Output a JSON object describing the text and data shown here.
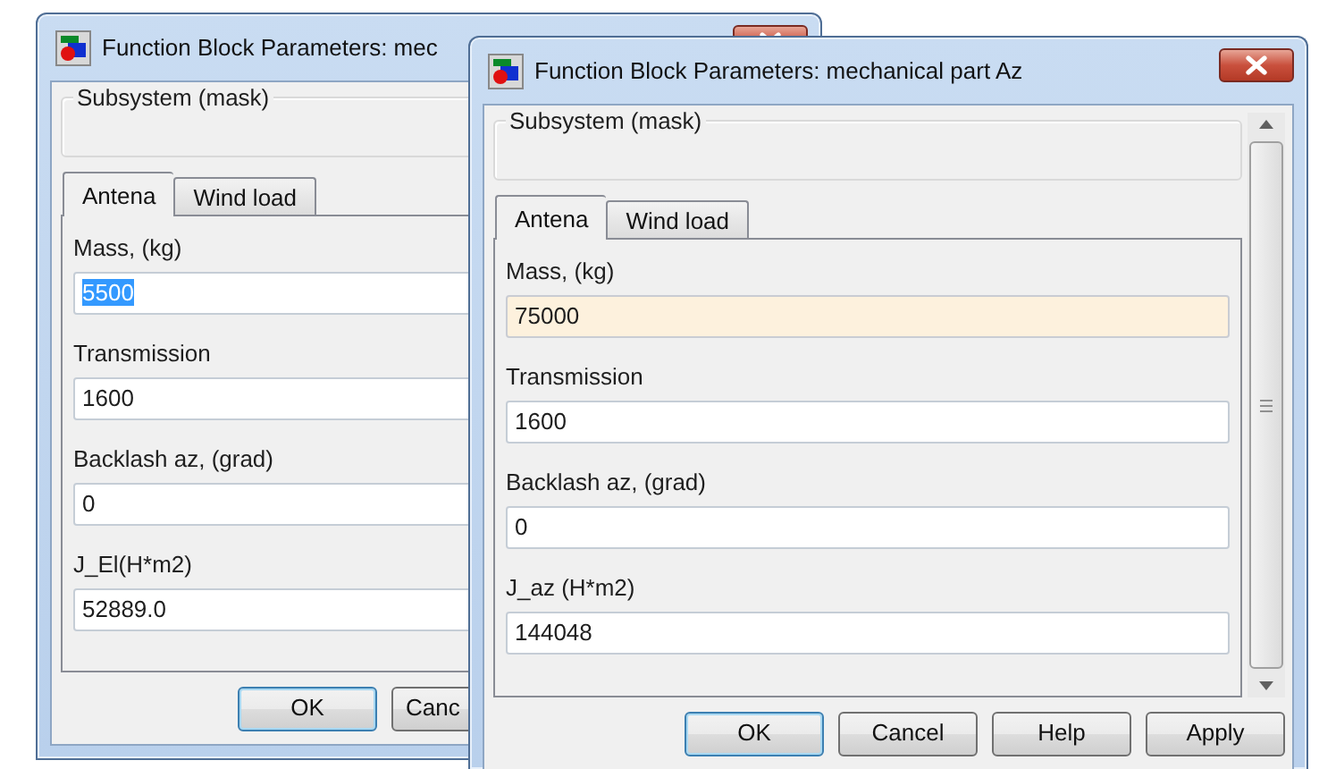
{
  "windows": [
    {
      "title": "Function Block Parameters: mec",
      "scrollbar": false,
      "group_label": "Subsystem (mask)",
      "tabs": [
        {
          "label": "Antena",
          "selected": true
        },
        {
          "label": "Wind load",
          "selected": false
        }
      ],
      "params": [
        {
          "label": "Mass, (kg)",
          "value": "5500",
          "highlighted": true,
          "focused": false
        },
        {
          "label": "Transmission",
          "value": "1600",
          "highlighted": false,
          "focused": false
        },
        {
          "label": "Backlash az, (grad)",
          "value": "0",
          "highlighted": false,
          "focused": false
        },
        {
          "label": "J_El(H*m2)",
          "value": "52889.0",
          "highlighted": false,
          "focused": false
        }
      ],
      "buttons": [
        {
          "label": "OK",
          "default": true
        },
        {
          "label": "Canc",
          "default": false
        }
      ]
    },
    {
      "title": "Function Block Parameters: mechanical part Az",
      "scrollbar": true,
      "group_label": "Subsystem (mask)",
      "tabs": [
        {
          "label": "Antena",
          "selected": true
        },
        {
          "label": "Wind load",
          "selected": false
        }
      ],
      "params": [
        {
          "label": "Mass, (kg)",
          "value": "75000",
          "highlighted": false,
          "focused": true
        },
        {
          "label": "Transmission",
          "value": "1600",
          "highlighted": false,
          "focused": false
        },
        {
          "label": "Backlash az, (grad)",
          "value": "0",
          "highlighted": false,
          "focused": false
        },
        {
          "label": "J_az  (H*m2)",
          "value": "144048",
          "highlighted": false,
          "focused": false
        }
      ],
      "buttons": [
        {
          "label": "OK",
          "default": true
        },
        {
          "label": "Cancel",
          "default": false
        },
        {
          "label": "Help",
          "default": false
        },
        {
          "label": "Apply",
          "default": false
        }
      ]
    }
  ]
}
